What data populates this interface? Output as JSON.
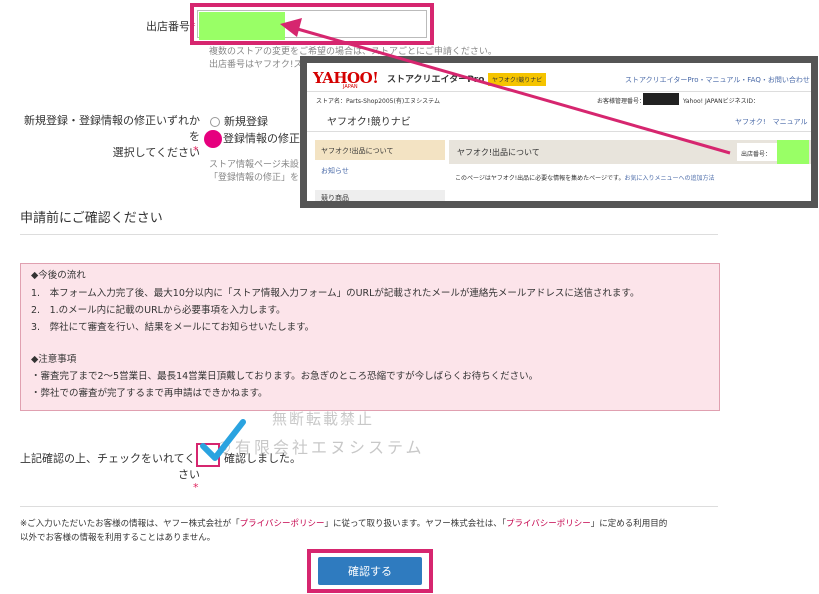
{
  "store_number": {
    "label": "出店番号",
    "required_mark": "*",
    "help_line1": "複数のストアの変更をご希望の場合は、ストアごとにご申請ください。",
    "help_line2": "出店番号はヤフオク!ストア"
  },
  "registration": {
    "label_line1": "新規登録・登録情報の修正いずれかを",
    "label_line2": "選択してください",
    "required_mark": "*",
    "option_new": "新規登録",
    "option_modify": "登録情報の修正",
    "help_line1": "ストア情報ページ未設",
    "help_line2": "「登録情報の修正」を"
  },
  "inset": {
    "logo": "YAHOO!",
    "logo_sub": "JAPAN",
    "app_title": "ストアクリエイターPro",
    "badge": "ヤフオク!競りナビ",
    "header_links": "ストアクリエイターPro・マニュアル・FAQ・お問い合わせ",
    "store_line": "ストア名：Parts-Shop2005(有)エヌシステム",
    "customer_label": "お客様管理番号：",
    "business_id": "Yahoo! JAPANビジネスID：",
    "page_title": "ヤフオク!競りナビ",
    "page_links": "ヤフオク!　マニュアル",
    "side_item1": "ヤフオク!出品について",
    "side_item2": "お知らせ",
    "side_item3": "競り商品",
    "content_title": "ヤフオク!出品について",
    "store_no_label": "出店番号：",
    "content_text": "このページはヤフオク!出品に必要な情報を集めたページです。",
    "content_link": "お気に入りメニューへの追加方法"
  },
  "section": {
    "title": "申請前にご確認ください"
  },
  "notice": {
    "flow_heading": "◆今後の流れ",
    "flow_items": [
      "1.　本フォーム入力完了後、最大10分以内に「ストア情報入力フォーム」のURLが記載されたメールが連絡先メールアドレスに送信されます。",
      "2.　1.のメール内に記載のURLから必要事項を入力します。",
      "3.　弊社にて審査を行い、結果をメールにてお知らせいたします。"
    ],
    "caution_heading": "◆注意事項",
    "caution_items": [
      "・審査完了まで2～5営業日、最長14営業日頂戴しております。お急ぎのところ恐縮ですが今しばらくお待ちください。",
      "・弊社での審査が完了するまで再申請はできかねます。"
    ]
  },
  "confirm": {
    "label_line1": "上記確認の上、チェックをいれてくだ",
    "label_line2": "さい",
    "required_mark": "*",
    "checkbox_text": "確認しました。"
  },
  "watermark": {
    "line1": "無断転載禁止",
    "line2": "©有限会社エヌシステム"
  },
  "privacy": {
    "t1": "※ご入力いただいたお客様の情報は、ヤフー株式会社が「",
    "link1": "プライバシーポリシー",
    "t2": "」に従って取り扱います。ヤフー株式会社は、「",
    "link2": "プライバシーポリシー",
    "t3": "」に定める利用目的",
    "t4": "以外でお客様の情報を利用することはありません。"
  },
  "submit": {
    "label": "確認する"
  },
  "colors": {
    "highlight": "#d6266f",
    "green": "#99ff66",
    "notice_bg": "#fce4ea",
    "button": "#2f7bbf",
    "check": "#2aa3e0"
  }
}
